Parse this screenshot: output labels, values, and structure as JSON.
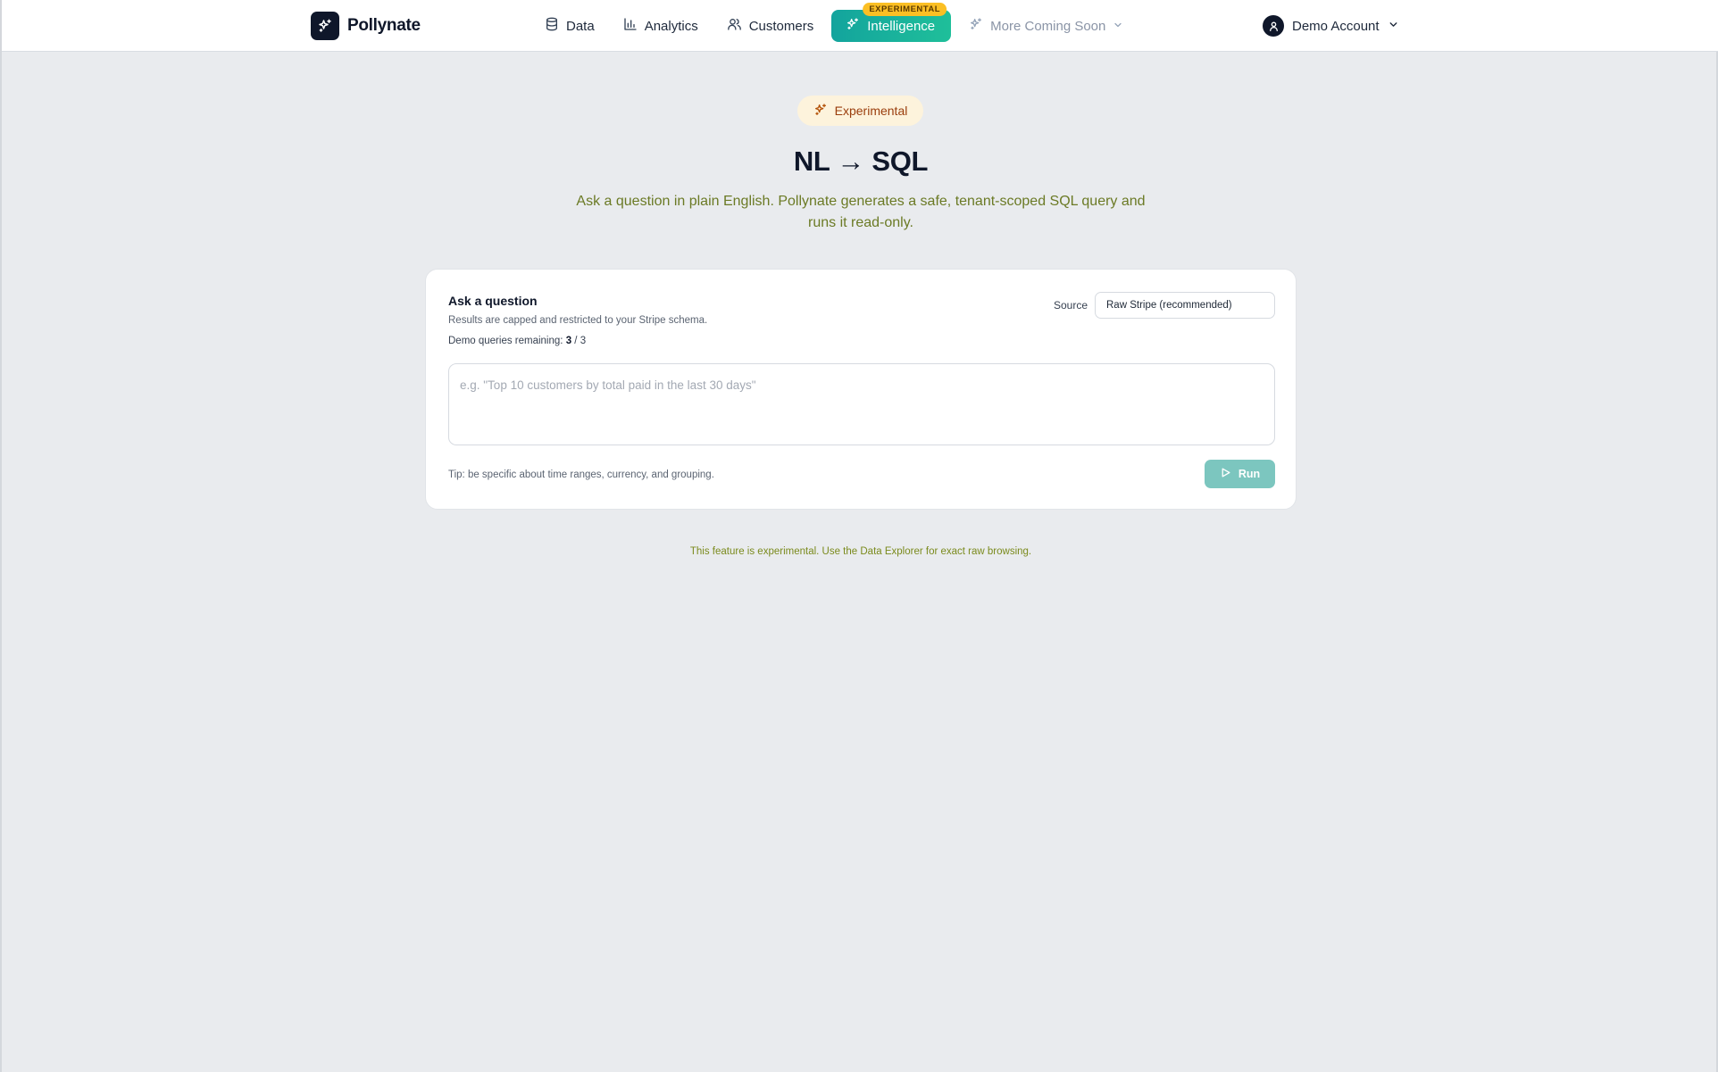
{
  "brand": {
    "name": "Pollynate",
    "logo_icon": "sparkles-icon"
  },
  "nav": {
    "items": [
      {
        "label": "Data",
        "icon": "database-icon"
      },
      {
        "label": "Analytics",
        "icon": "bar-chart-icon"
      },
      {
        "label": "Customers",
        "icon": "users-icon"
      },
      {
        "label": "Intelligence",
        "icon": "sparkles-icon",
        "tag": "EXPERIMENTAL",
        "active": true
      },
      {
        "label": "More Coming Soon",
        "icon": "sparkles-icon"
      }
    ]
  },
  "account": {
    "label": "Demo Account",
    "icon": "user-icon"
  },
  "hero": {
    "badge": "Experimental",
    "title": "NL → SQL",
    "subtitle": "Ask a question in plain English. Pollynate generates a safe, tenant-scoped SQL query and runs it read-only."
  },
  "card": {
    "title": "Ask a question",
    "subtitle": "Results are capped and restricted to your Stripe schema.",
    "quota_prefix": "Demo queries remaining:",
    "quota_remaining": "3",
    "quota_sep": "/",
    "quota_total": "3",
    "source_label": "Source",
    "source_value": "Raw Stripe (recommended)",
    "question_placeholder": "e.g. \"Top 10 customers by total paid in the last 30 days\"",
    "question_value": "",
    "tip": "Tip: be specific about time ranges, currency, and grouping.",
    "run_label": "Run"
  },
  "footer_note": "This feature is experimental. Use the Data Explorer for exact raw browsing.",
  "colors": {
    "accent": "#13a49d",
    "accent_disabled": "#7cc6bf",
    "badge_bg": "#fdf3dc",
    "badge_text": "#9a3d0c",
    "tag_bg": "#fbbf24",
    "subtitle_text": "#6b7a25",
    "page_bg": "#e9ebee"
  }
}
